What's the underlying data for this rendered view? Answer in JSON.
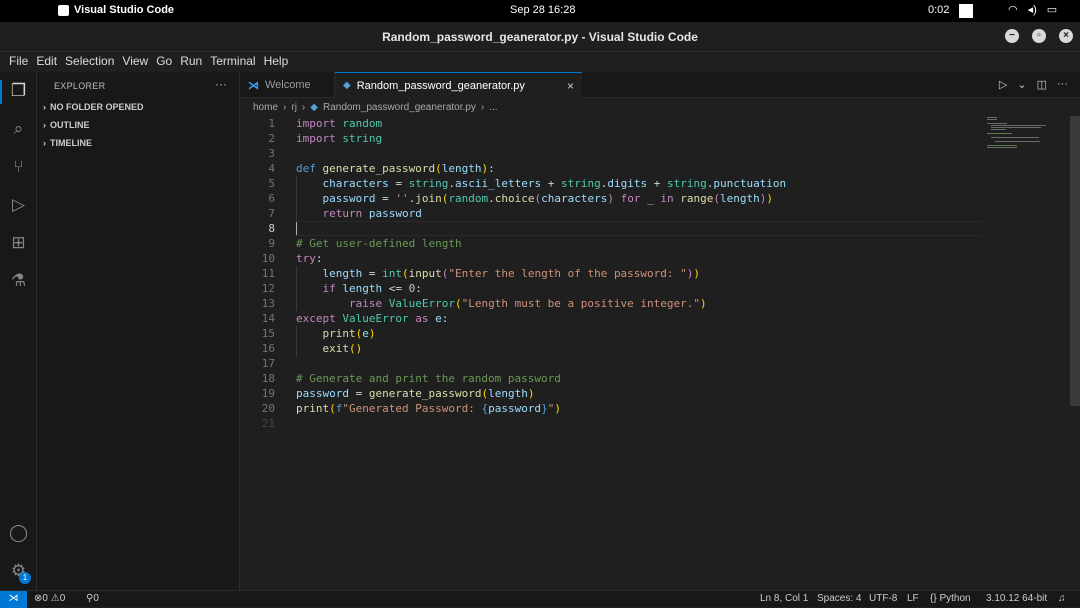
{
  "system_bar": {
    "apple_glyph": "",
    "app_name": "Visual Studio Code",
    "clock": "Sep 28  16:28",
    "time": "0:02"
  },
  "window": {
    "title": "Random_password_geanerator.py - Visual Studio Code"
  },
  "menu": [
    "File",
    "Edit",
    "Selection",
    "View",
    "Go",
    "Run",
    "Terminal",
    "Help"
  ],
  "sidebar": {
    "header": "EXPLORER",
    "more": "···",
    "sections": [
      "NO FOLDER OPENED",
      "OUTLINE",
      "TIMELINE"
    ]
  },
  "tabs": [
    {
      "label": "Welcome",
      "active": false
    },
    {
      "label": "Random_password_geanerator.py",
      "active": true
    }
  ],
  "breadcrumb": {
    "parts": [
      "home",
      "rj",
      "Random_password_geanerator.py",
      "..."
    ]
  },
  "editor": {
    "current_line": 8,
    "line_numbers": [
      "1",
      "2",
      "3",
      "4",
      "5",
      "6",
      "7",
      "8",
      "9",
      "10",
      "11",
      "12",
      "13",
      "14",
      "15",
      "16",
      "17",
      "18",
      "19",
      "20",
      "21"
    ]
  },
  "status_bar": {
    "errors": "0",
    "warnings": "0",
    "ports": "0",
    "position": "Ln 8, Col 1",
    "spaces": "Spaces: 4",
    "encoding": "UTF-8",
    "eol": "LF",
    "language": "Python",
    "interpreter": "3.10.12 64-bit"
  },
  "settings_badge": "1",
  "colors": {
    "accent": "#0078d4",
    "keyword": "#569cd6",
    "control": "#c586c0",
    "function": "#dcdcaa",
    "string": "#ce9178",
    "comment": "#6a9955"
  }
}
